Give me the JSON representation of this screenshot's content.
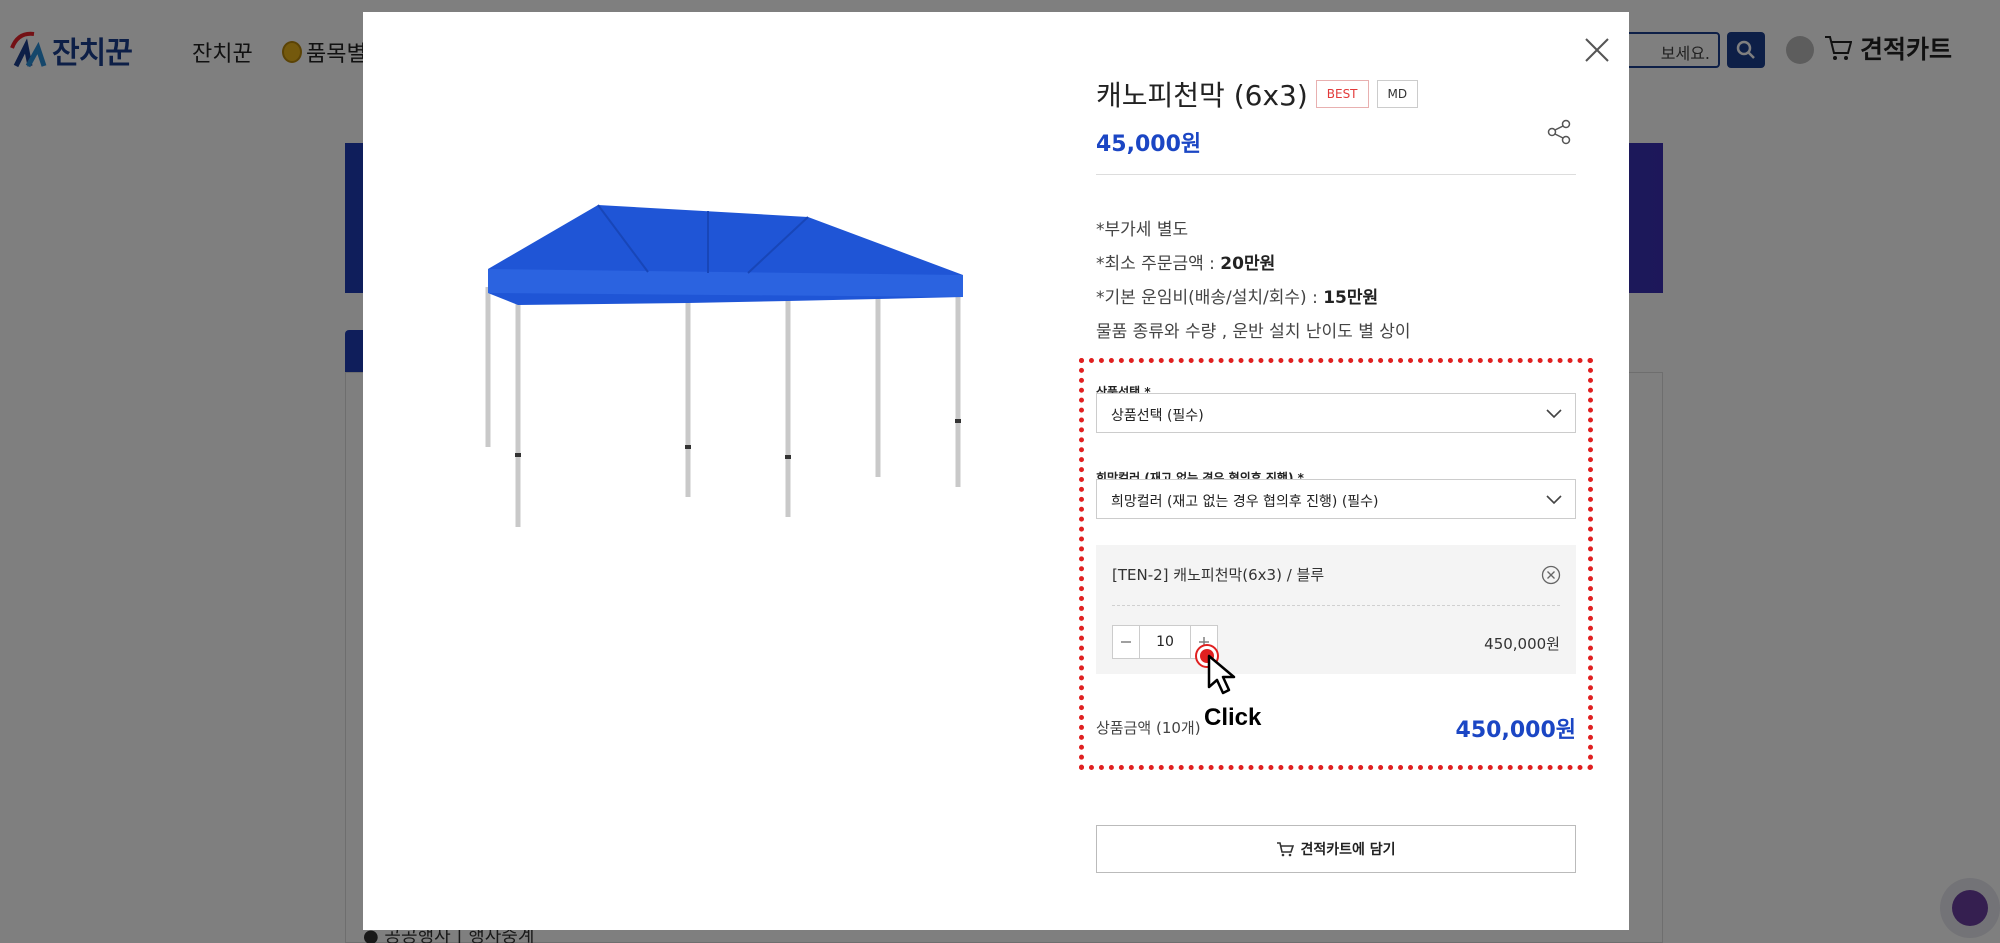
{
  "background": {
    "logo_text": "잔치꾼",
    "nav": [
      "잔치꾼",
      "품목별"
    ],
    "search_placeholder": "보세요.",
    "cart_label": "견적카트",
    "footer_text": "● 공공행사 | 행사중계"
  },
  "modal": {
    "title": "캐노피천막 (6x3)",
    "badges": {
      "best": "BEST",
      "md": "MD"
    },
    "price": "45,000원",
    "notes": [
      {
        "text": "*부가세 별도",
        "bold": ""
      },
      {
        "text": "*최소 주문금액 : ",
        "bold": "20만원"
      },
      {
        "text": "*기본 운임비(배송/설치/회수) : ",
        "bold": "15만원"
      },
      {
        "text": "물품 종류와 수량 , 운반 설치 난이도 별 상이",
        "bold": ""
      }
    ],
    "product_select": {
      "label": "상품선택 *",
      "value": "상품선택 (필수)"
    },
    "color_select": {
      "label": "희망컬러 (재고 없는 경우 협의후 진행) *",
      "value": "희망컬러 (재고 없는 경우 협의후 진행) (필수)"
    },
    "selected_option": {
      "name": "[TEN-2] 캐노피천막(6x3) / 블루",
      "quantity": "10",
      "price": "450,000원"
    },
    "total": {
      "label": "상품금액 (10개)",
      "price": "450,000원"
    },
    "cart_button": "견적카트에 담기",
    "annotation": "Click"
  },
  "colors": {
    "accent": "#1b46c4",
    "highlight": "#e02020",
    "tent": "#1f55d6"
  }
}
